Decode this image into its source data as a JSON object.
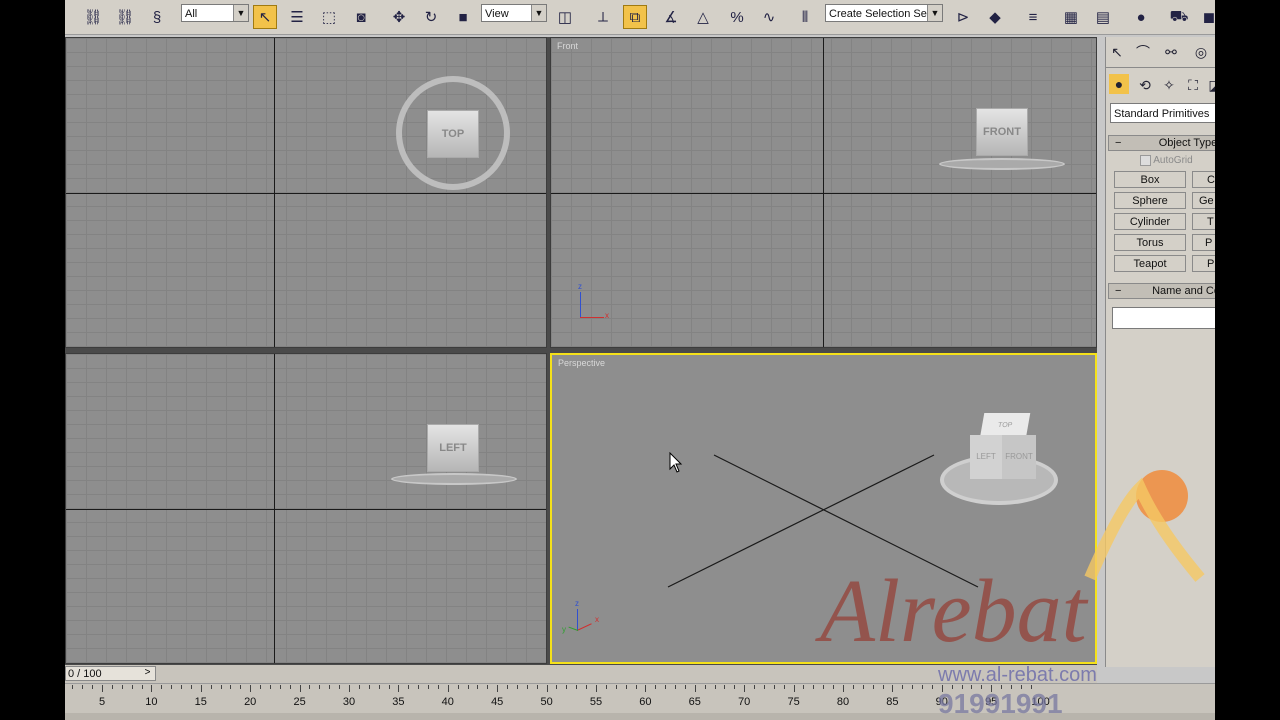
{
  "toolbar": {
    "selection_filter": "All",
    "reference_coord": "View",
    "named_selection": "Create Selection Set"
  },
  "viewports": {
    "top": {
      "label": "",
      "cube_label": "TOP"
    },
    "front": {
      "label": "Front",
      "cube_label": "FRONT"
    },
    "left": {
      "label": "",
      "cube_label": "LEFT"
    },
    "perspective": {
      "label": "Perspective",
      "cube_top": "TOP",
      "cube_left": "LEFT",
      "cube_front": "FRONT"
    },
    "axis_x": "x",
    "axis_z": "z",
    "axis_y": "y"
  },
  "command_panel": {
    "category": "Standard Primitives",
    "object_type_title": "Object Type",
    "autogrid": "AutoGrid",
    "buttons_left": [
      "Box",
      "Sphere",
      "Cylinder",
      "Torus",
      "Teapot"
    ],
    "buttons_right": [
      "C",
      "Ge",
      "T",
      "P",
      "P"
    ],
    "name_color_title": "Name and Co"
  },
  "time_slider": {
    "label": "0 / 100",
    "next": ">"
  },
  "track_ticks": [
    "5",
    "10",
    "15",
    "20",
    "25",
    "30",
    "35",
    "40",
    "45",
    "50",
    "55",
    "60",
    "65",
    "70",
    "75",
    "80",
    "85",
    "90",
    "95",
    "100"
  ],
  "watermark": {
    "brand": "Alrebat",
    "url": "www.al-rebat.com",
    "phone": "91991991"
  },
  "colors": {
    "active_viewport": "#f5e11a",
    "active_tool": "#f2c24a"
  }
}
